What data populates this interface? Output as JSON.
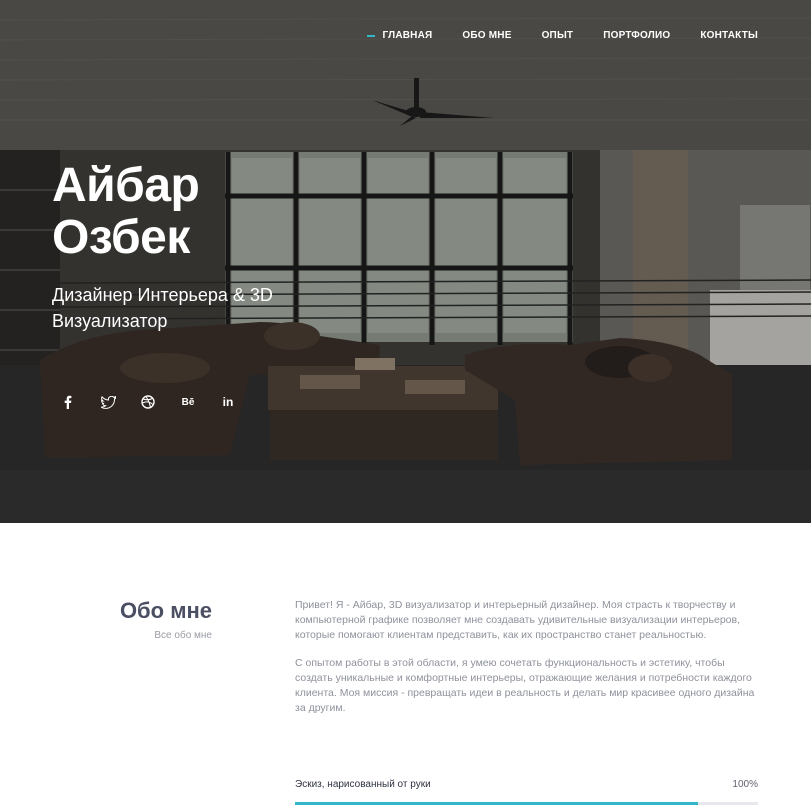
{
  "nav": {
    "items": [
      {
        "label": "ГЛАВНАЯ",
        "active": true
      },
      {
        "label": "ОБО МНЕ",
        "active": false
      },
      {
        "label": "ОПЫТ",
        "active": false
      },
      {
        "label": "ПОРТФОЛИО",
        "active": false
      },
      {
        "label": "КОНТАКТЫ",
        "active": false
      }
    ]
  },
  "hero": {
    "name_line1": "Айбар",
    "name_line2": "Озбек",
    "role_line1": "Дизайнер Интерьера & 3D",
    "role_line2": "Визуализатор"
  },
  "social": [
    {
      "icon": "facebook-icon",
      "glyph": "f"
    },
    {
      "icon": "twitter-icon",
      "glyph": "🐦"
    },
    {
      "icon": "dribbble-icon",
      "glyph": "◍"
    },
    {
      "icon": "behance-icon",
      "glyph": "Bē"
    },
    {
      "icon": "linkedin-icon",
      "glyph": "in"
    }
  ],
  "about": {
    "title": "Обо мне",
    "subtitle": "Все обо мне",
    "paragraph1": "Привет! Я - Айбар, 3D визуализатор и интерьерный дизайнер. Моя страсть к творчеству и компьютерной графике позволяет мне создавать удивительные визуализации интерьеров, которые помогают клиентам представить, как их пространство станет реальностью.",
    "paragraph2": "С опытом работы в этой области, я умею сочетать функциональность и эстетику, чтобы создать уникальные и комфортные интерьеры, отражающие желания и потребности каждого клиента. Моя миссия - превращать идеи в реальность и делать мир красивее одного дизайна за другим."
  },
  "skills": [
    {
      "name": "Эскиз, нарисованный от руки",
      "value_label": "100%",
      "fraction": 0.87
    }
  ],
  "colors": {
    "accent": "#31b7c8",
    "heading": "#4b4f63",
    "body_text": "#8f929c"
  }
}
